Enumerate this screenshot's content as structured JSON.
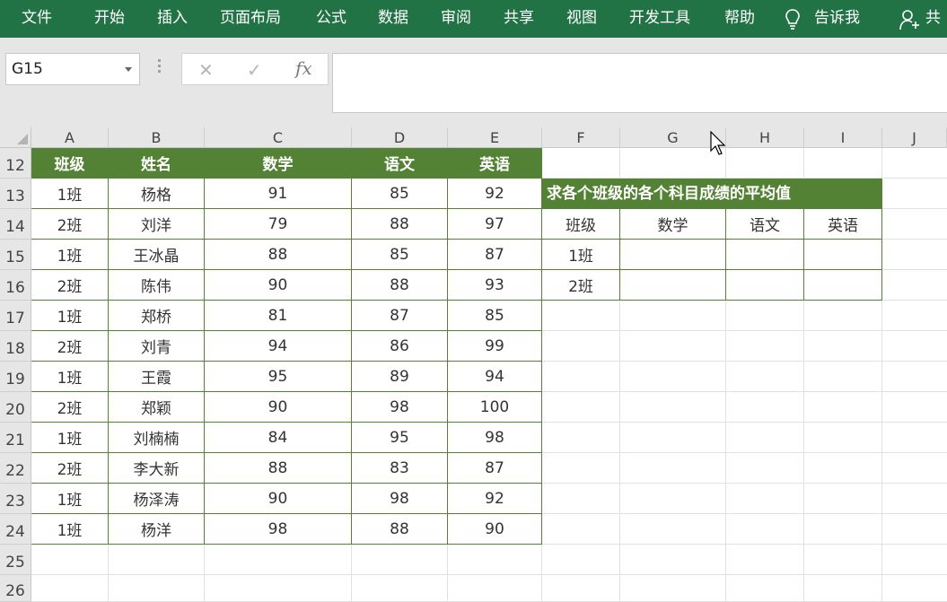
{
  "ribbon": {
    "tabs": [
      "文件",
      "开始",
      "插入",
      "页面布局",
      "公式",
      "数据",
      "审阅",
      "共享",
      "视图",
      "开发工具",
      "帮助"
    ],
    "tell_me": "告诉我",
    "share": "共"
  },
  "formula_bar": {
    "name_box": "G15",
    "fx": "fx",
    "formula_value": ""
  },
  "sheet": {
    "columns": [
      "A",
      "B",
      "C",
      "D",
      "E",
      "F",
      "G",
      "H",
      "I",
      "J"
    ],
    "rows": [
      "12",
      "13",
      "14",
      "15",
      "16",
      "17",
      "18",
      "19",
      "20",
      "21",
      "22",
      "23",
      "24",
      "25",
      "26"
    ],
    "data_table": {
      "headers": [
        "班级",
        "姓名",
        "数学",
        "语文",
        "英语"
      ],
      "rows": [
        [
          "1班",
          "杨格",
          "91",
          "85",
          "92"
        ],
        [
          "2班",
          "刘洋",
          "79",
          "88",
          "97"
        ],
        [
          "1班",
          "王冰晶",
          "88",
          "85",
          "87"
        ],
        [
          "2班",
          "陈伟",
          "90",
          "88",
          "93"
        ],
        [
          "1班",
          "郑桥",
          "81",
          "87",
          "85"
        ],
        [
          "2班",
          "刘青",
          "94",
          "86",
          "99"
        ],
        [
          "1班",
          "王霞",
          "95",
          "89",
          "94"
        ],
        [
          "2班",
          "郑颖",
          "90",
          "98",
          "100"
        ],
        [
          "1班",
          "刘楠楠",
          "84",
          "95",
          "98"
        ],
        [
          "2班",
          "李大新",
          "88",
          "83",
          "87"
        ],
        [
          "1班",
          "杨泽涛",
          "90",
          "98",
          "92"
        ],
        [
          "1班",
          "杨洋",
          "98",
          "88",
          "90"
        ]
      ]
    },
    "summary_table": {
      "title": "求各个班级的各个科目成绩的平均值",
      "headers": [
        "班级",
        "数学",
        "语文",
        "英语"
      ],
      "rows": [
        [
          "1班",
          "",
          "",
          ""
        ],
        [
          "2班",
          "",
          "",
          ""
        ]
      ]
    }
  },
  "colors": {
    "ribbon": "#217346",
    "header_fill": "#548235",
    "border": "#548235"
  }
}
